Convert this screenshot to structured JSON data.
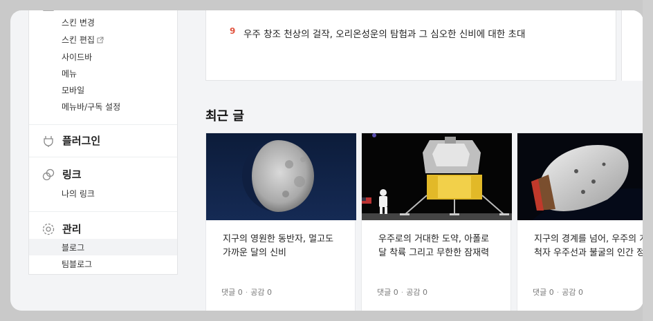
{
  "sidebar": {
    "skin_items": [
      {
        "label": "스킨 변경"
      },
      {
        "label": "스킨 편집",
        "external": true
      },
      {
        "label": "사이드바"
      },
      {
        "label": "메뉴"
      },
      {
        "label": "모바일"
      },
      {
        "label": "메뉴바/구독 설정"
      }
    ],
    "plugin": {
      "title": "플러그인",
      "icon": "plug-icon"
    },
    "link": {
      "title": "링크",
      "icon": "link-icon",
      "items": [
        {
          "label": "나의 링크"
        }
      ]
    },
    "manage": {
      "title": "관리",
      "icon": "gear-icon",
      "items": [
        {
          "label": "블로그",
          "active": true
        },
        {
          "label": "팀블로그"
        }
      ]
    }
  },
  "popular": {
    "items": [
      {
        "rank": "9",
        "title": "우주 창조 천상의 걸작, 오리온성운의 탐험과 그 심오한 신비에 대한 초대"
      }
    ]
  },
  "recent": {
    "heading": "최근 글",
    "cards": [
      {
        "title": "지구의 영원한 동반자, 멀고도 가까운 달의 신비",
        "comments_label": "댓글 0",
        "likes_label": "공감 0",
        "image": "moon"
      },
      {
        "title": "우주로의 거대한 도약, 아폴로 달 착륙 그리고 무한한 잠재력",
        "comments_label": "댓글 0",
        "likes_label": "공감 0",
        "image": "lunar-module"
      },
      {
        "title": "지구의 경계를 넘어, 우주의 개척자 우주선과 불굴의 인간 정신",
        "comments_label": "댓글 0",
        "likes_label": "공감 0",
        "image": "spacecraft"
      }
    ]
  },
  "colors": {
    "accent": "#e1543f",
    "panel_bg": "#f3f4f6"
  }
}
